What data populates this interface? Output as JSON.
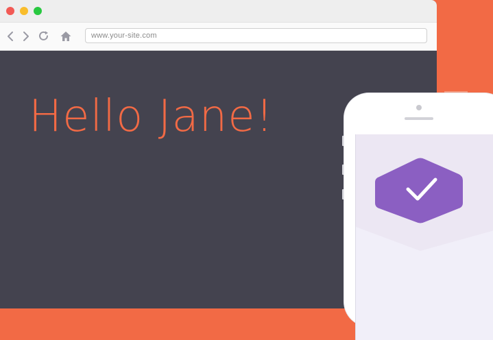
{
  "window": {
    "traffic_lights": [
      "close",
      "minimize",
      "zoom"
    ],
    "colors": {
      "close": "#f25a55",
      "minimize": "#f9bd2c",
      "zoom": "#28c840"
    }
  },
  "toolbar": {
    "buttons": [
      "back-icon",
      "forward-icon",
      "reload-icon",
      "home-icon"
    ],
    "address": "www.your-site.com"
  },
  "page": {
    "greeting": "Hello Jane!",
    "background_color": "#44434f",
    "accent_color": "#f26a45"
  },
  "phone": {
    "badge_icon": "check-icon",
    "badge_color": "#8b5fc2",
    "screen_color": "#f1eff9"
  }
}
